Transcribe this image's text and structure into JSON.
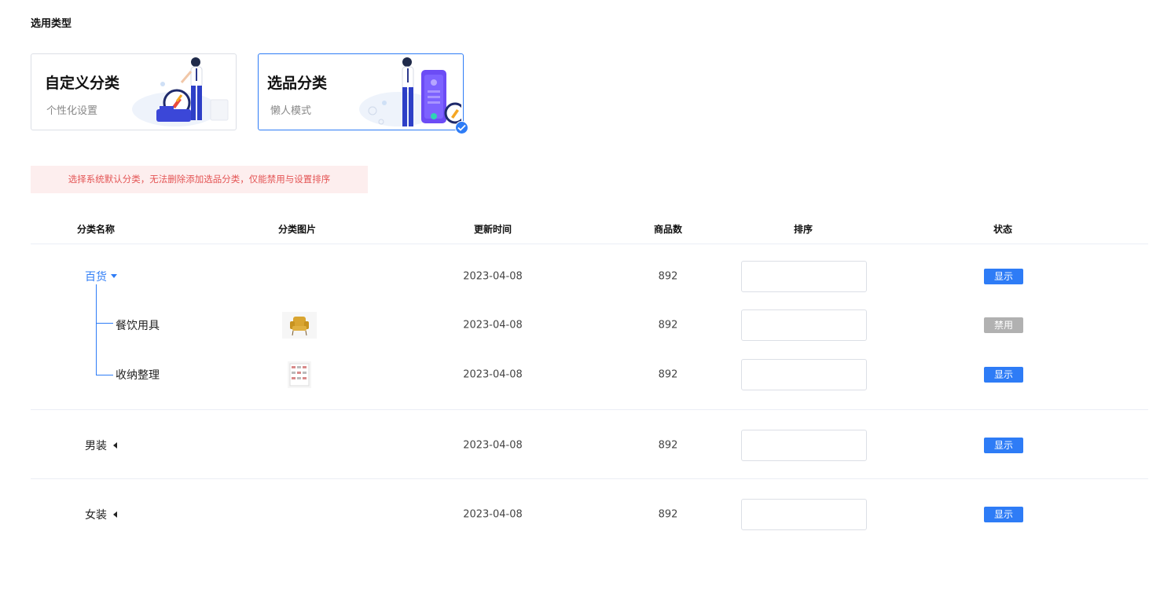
{
  "section_title": "选用类型",
  "type_cards": [
    {
      "title": "自定义分类",
      "subtitle": "个性化设置",
      "selected": false
    },
    {
      "title": "选品分类",
      "subtitle": "懒人模式",
      "selected": true
    }
  ],
  "notice": "选择系统默认分类，无法删除添加选品分类，仅能禁用与设置排序",
  "table": {
    "headers": {
      "name": "分类名称",
      "image": "分类图片",
      "updated": "更新时间",
      "count": "商品数",
      "sort": "排序",
      "status": "状态"
    },
    "rows": [
      {
        "name": "百货",
        "expanded": true,
        "image": "",
        "updated": "2023-04-08",
        "count": "892",
        "sort": "",
        "status": "显示",
        "status_type": "show"
      },
      {
        "name": "餐饮用具",
        "child": true,
        "image": "armchair-thumbnail",
        "updated": "2023-04-08",
        "count": "892",
        "sort": "",
        "status": "禁用",
        "status_type": "disabled"
      },
      {
        "name": "收纳整理",
        "child": true,
        "image": "cabinet-thumbnail",
        "updated": "2023-04-08",
        "count": "892",
        "sort": "",
        "status": "显示",
        "status_type": "show"
      },
      {
        "name": "男装",
        "expanded": false,
        "image": "",
        "updated": "2023-04-08",
        "count": "892",
        "sort": "",
        "status": "显示",
        "status_type": "show"
      },
      {
        "name": "女装",
        "expanded": false,
        "image": "",
        "updated": "2023-04-08",
        "count": "892",
        "sort": "",
        "status": "显示",
        "status_type": "show"
      }
    ]
  },
  "colors": {
    "accent": "#2e7cf6",
    "disabled": "#b1b1b1",
    "notice_bg": "#fdeeee",
    "notice_text": "#e45555"
  }
}
